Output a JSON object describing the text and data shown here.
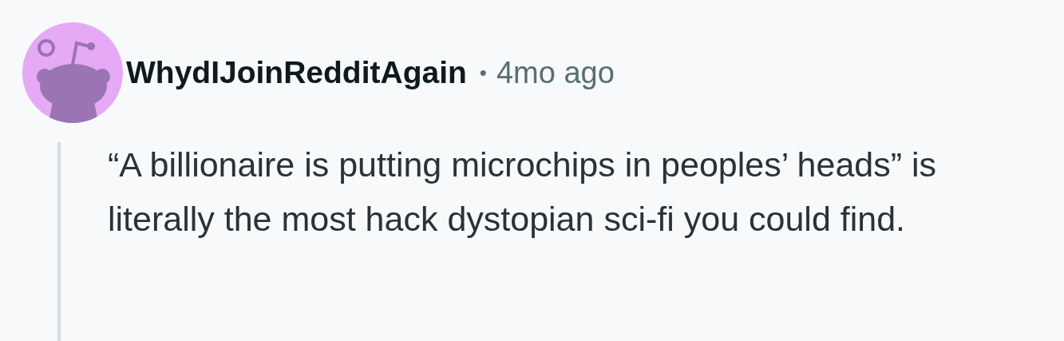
{
  "comment": {
    "author": "WhydIJoinRedditAgain",
    "separator": "•",
    "time": "4mo ago",
    "body": "“A billionaire is putting microchips in peoples’ heads” is literally the most hack dystopian sci-fi you could find."
  }
}
